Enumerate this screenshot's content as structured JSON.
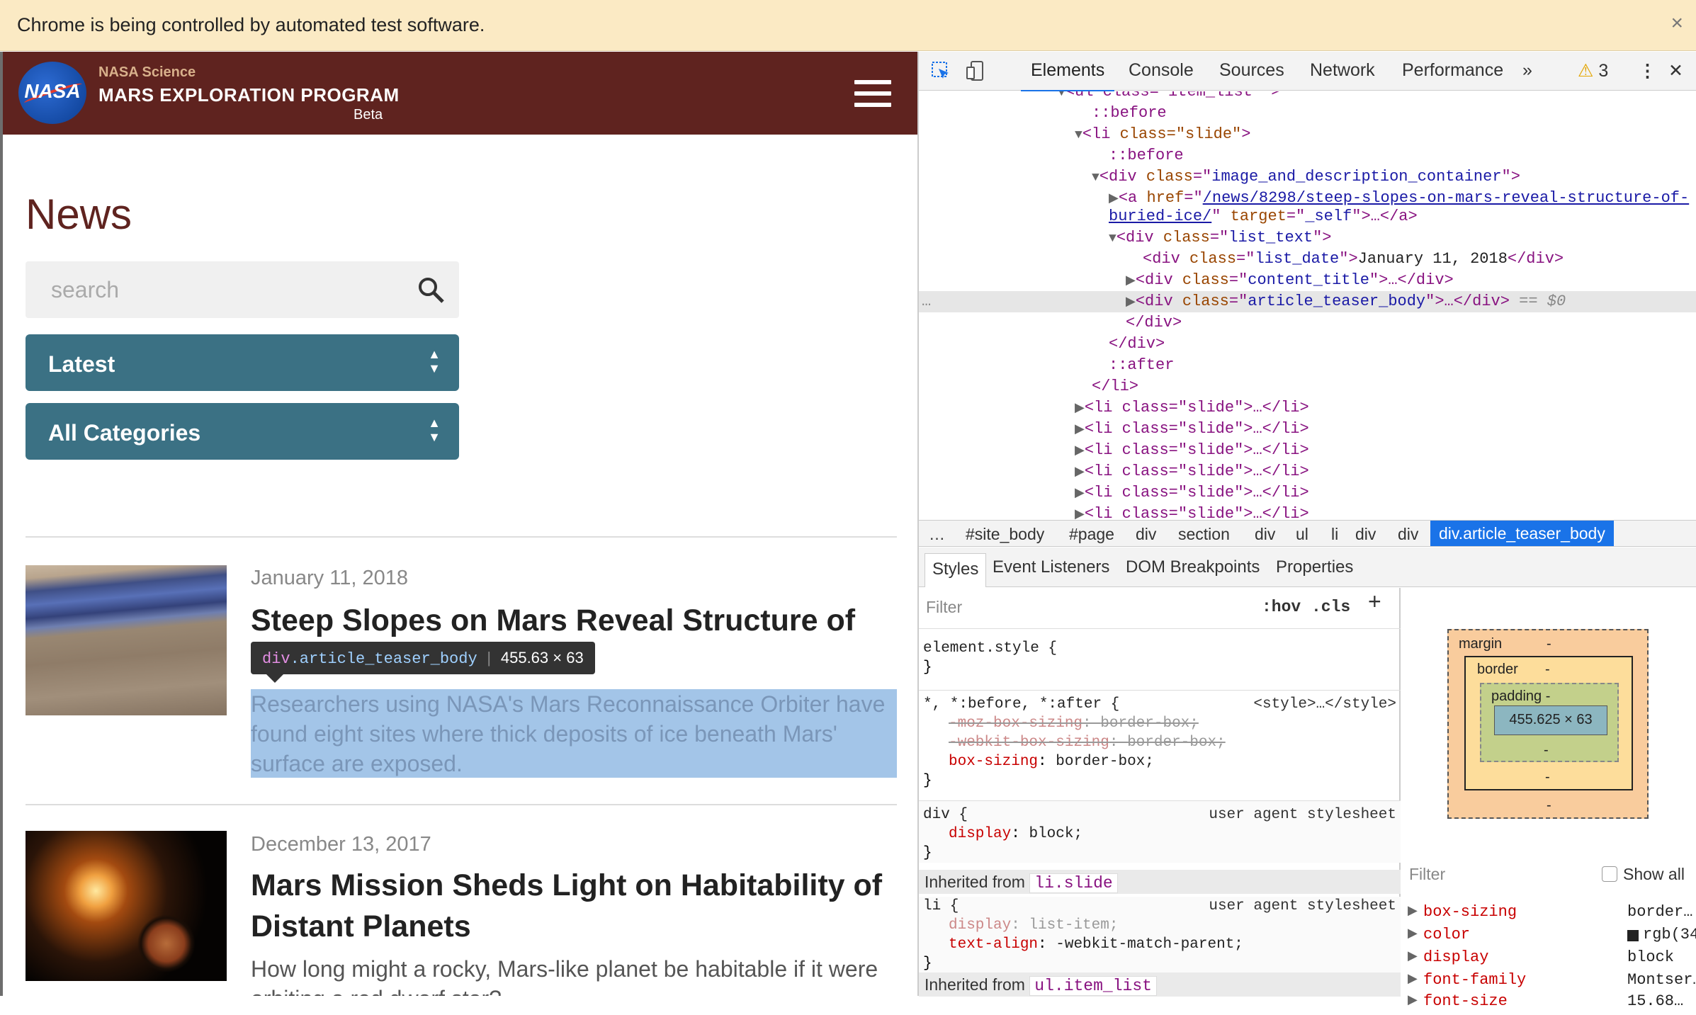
{
  "infobar": {
    "message": "Chrome is being controlled by automated test software.",
    "close": "×"
  },
  "site": {
    "logo_text": "NASA",
    "science": "NASA Science",
    "program": "MARS EXPLORATION PROGRAM",
    "beta": "Beta",
    "news_title": "News",
    "search_placeholder": "search",
    "sort_select": "Latest",
    "category_select": "All Categories",
    "articles": [
      {
        "date": "January 11, 2018",
        "title": "Steep Slopes on Mars Reveal Structure of",
        "teaser": "Researchers using NASA's Mars Reconnaissance Orbiter have found eight sites where thick deposits of ice beneath Mars' surface are exposed."
      },
      {
        "date": "December 13, 2017",
        "title": "Mars Mission Sheds Light on Habitability of Distant Planets",
        "teaser": "How long might a rocky, Mars-like planet be habitable if it were orbiting a red dwarf star?"
      }
    ],
    "tooltip": {
      "tag": "div",
      "cls": ".article_teaser_body",
      "size": "455.63 × 63"
    }
  },
  "devtools": {
    "tabs": [
      "Elements",
      "Console",
      "Sources",
      "Network",
      "Performance"
    ],
    "more": "»",
    "warnings": "3",
    "dom": {
      "l0": "<ul class=\"item_list \">",
      "before1": "::before",
      "li_open": "class=\"slide\"",
      "before2": "::before",
      "div_container": "image_and_description_container",
      "a_href": "/news/8298/steep-slopes-on-mars-reveal-structure-of-",
      "a_href2": "buried-ice/",
      "a_target": "_self",
      "list_text": "list_text",
      "list_date": "list_date",
      "list_date_val": "January 11, 2018",
      "content_title": "content_title",
      "teaser_body": "article_teaser_body",
      "eq0": "== $0",
      "after": "::after",
      "collapsed_slide": "<li class=\"slide\">…</li>"
    },
    "crumbs": [
      "…",
      "#site_body",
      "#page",
      "div",
      "section",
      "div",
      "ul",
      "li",
      "div",
      "div",
      "div.article_teaser_body"
    ],
    "subtabs": [
      "Styles",
      "Event Listeners",
      "DOM Breakpoints",
      "Properties"
    ],
    "filter": "Filter",
    "hov": ":hov",
    "cls": ".cls",
    "plus": "+",
    "rules": {
      "element_style": "element.style {",
      "universal_sel": "*, *:before, *:after {",
      "universal_src": "<style>…</style>",
      "moz": "-moz-box-sizing",
      "moz_val": "border-box;",
      "webkit": "-webkit-box-sizing",
      "webkit_val": "border-box;",
      "bs": "box-sizing",
      "bs_val": "border-box;",
      "div_sel": "div {",
      "ua": "user agent stylesheet",
      "display": "display",
      "display_val": "block;",
      "inh1_label": "Inherited from",
      "inh1_chip": "li.slide",
      "li_sel": "li {",
      "li_display_val": "list-item;",
      "text_align": "text-align",
      "text_align_val": "-webkit-match-parent;",
      "inh2_label": "Inherited from",
      "inh2_chip": "ul.item_list",
      "close": "}"
    },
    "boxmodel": {
      "margin": "margin",
      "border": "border",
      "padding": "padding -",
      "content": "455.625 × 63",
      "dash": "-"
    },
    "computed": {
      "filter": "Filter",
      "show_all": "Show all",
      "props": [
        {
          "name": "box-sizing",
          "value": "border…"
        },
        {
          "name": "color",
          "value": "rgb(34"
        },
        {
          "name": "display",
          "value": "block"
        },
        {
          "name": "font-family",
          "value": "Montser…"
        },
        {
          "name": "font-size",
          "value": "15.68…"
        }
      ]
    }
  }
}
